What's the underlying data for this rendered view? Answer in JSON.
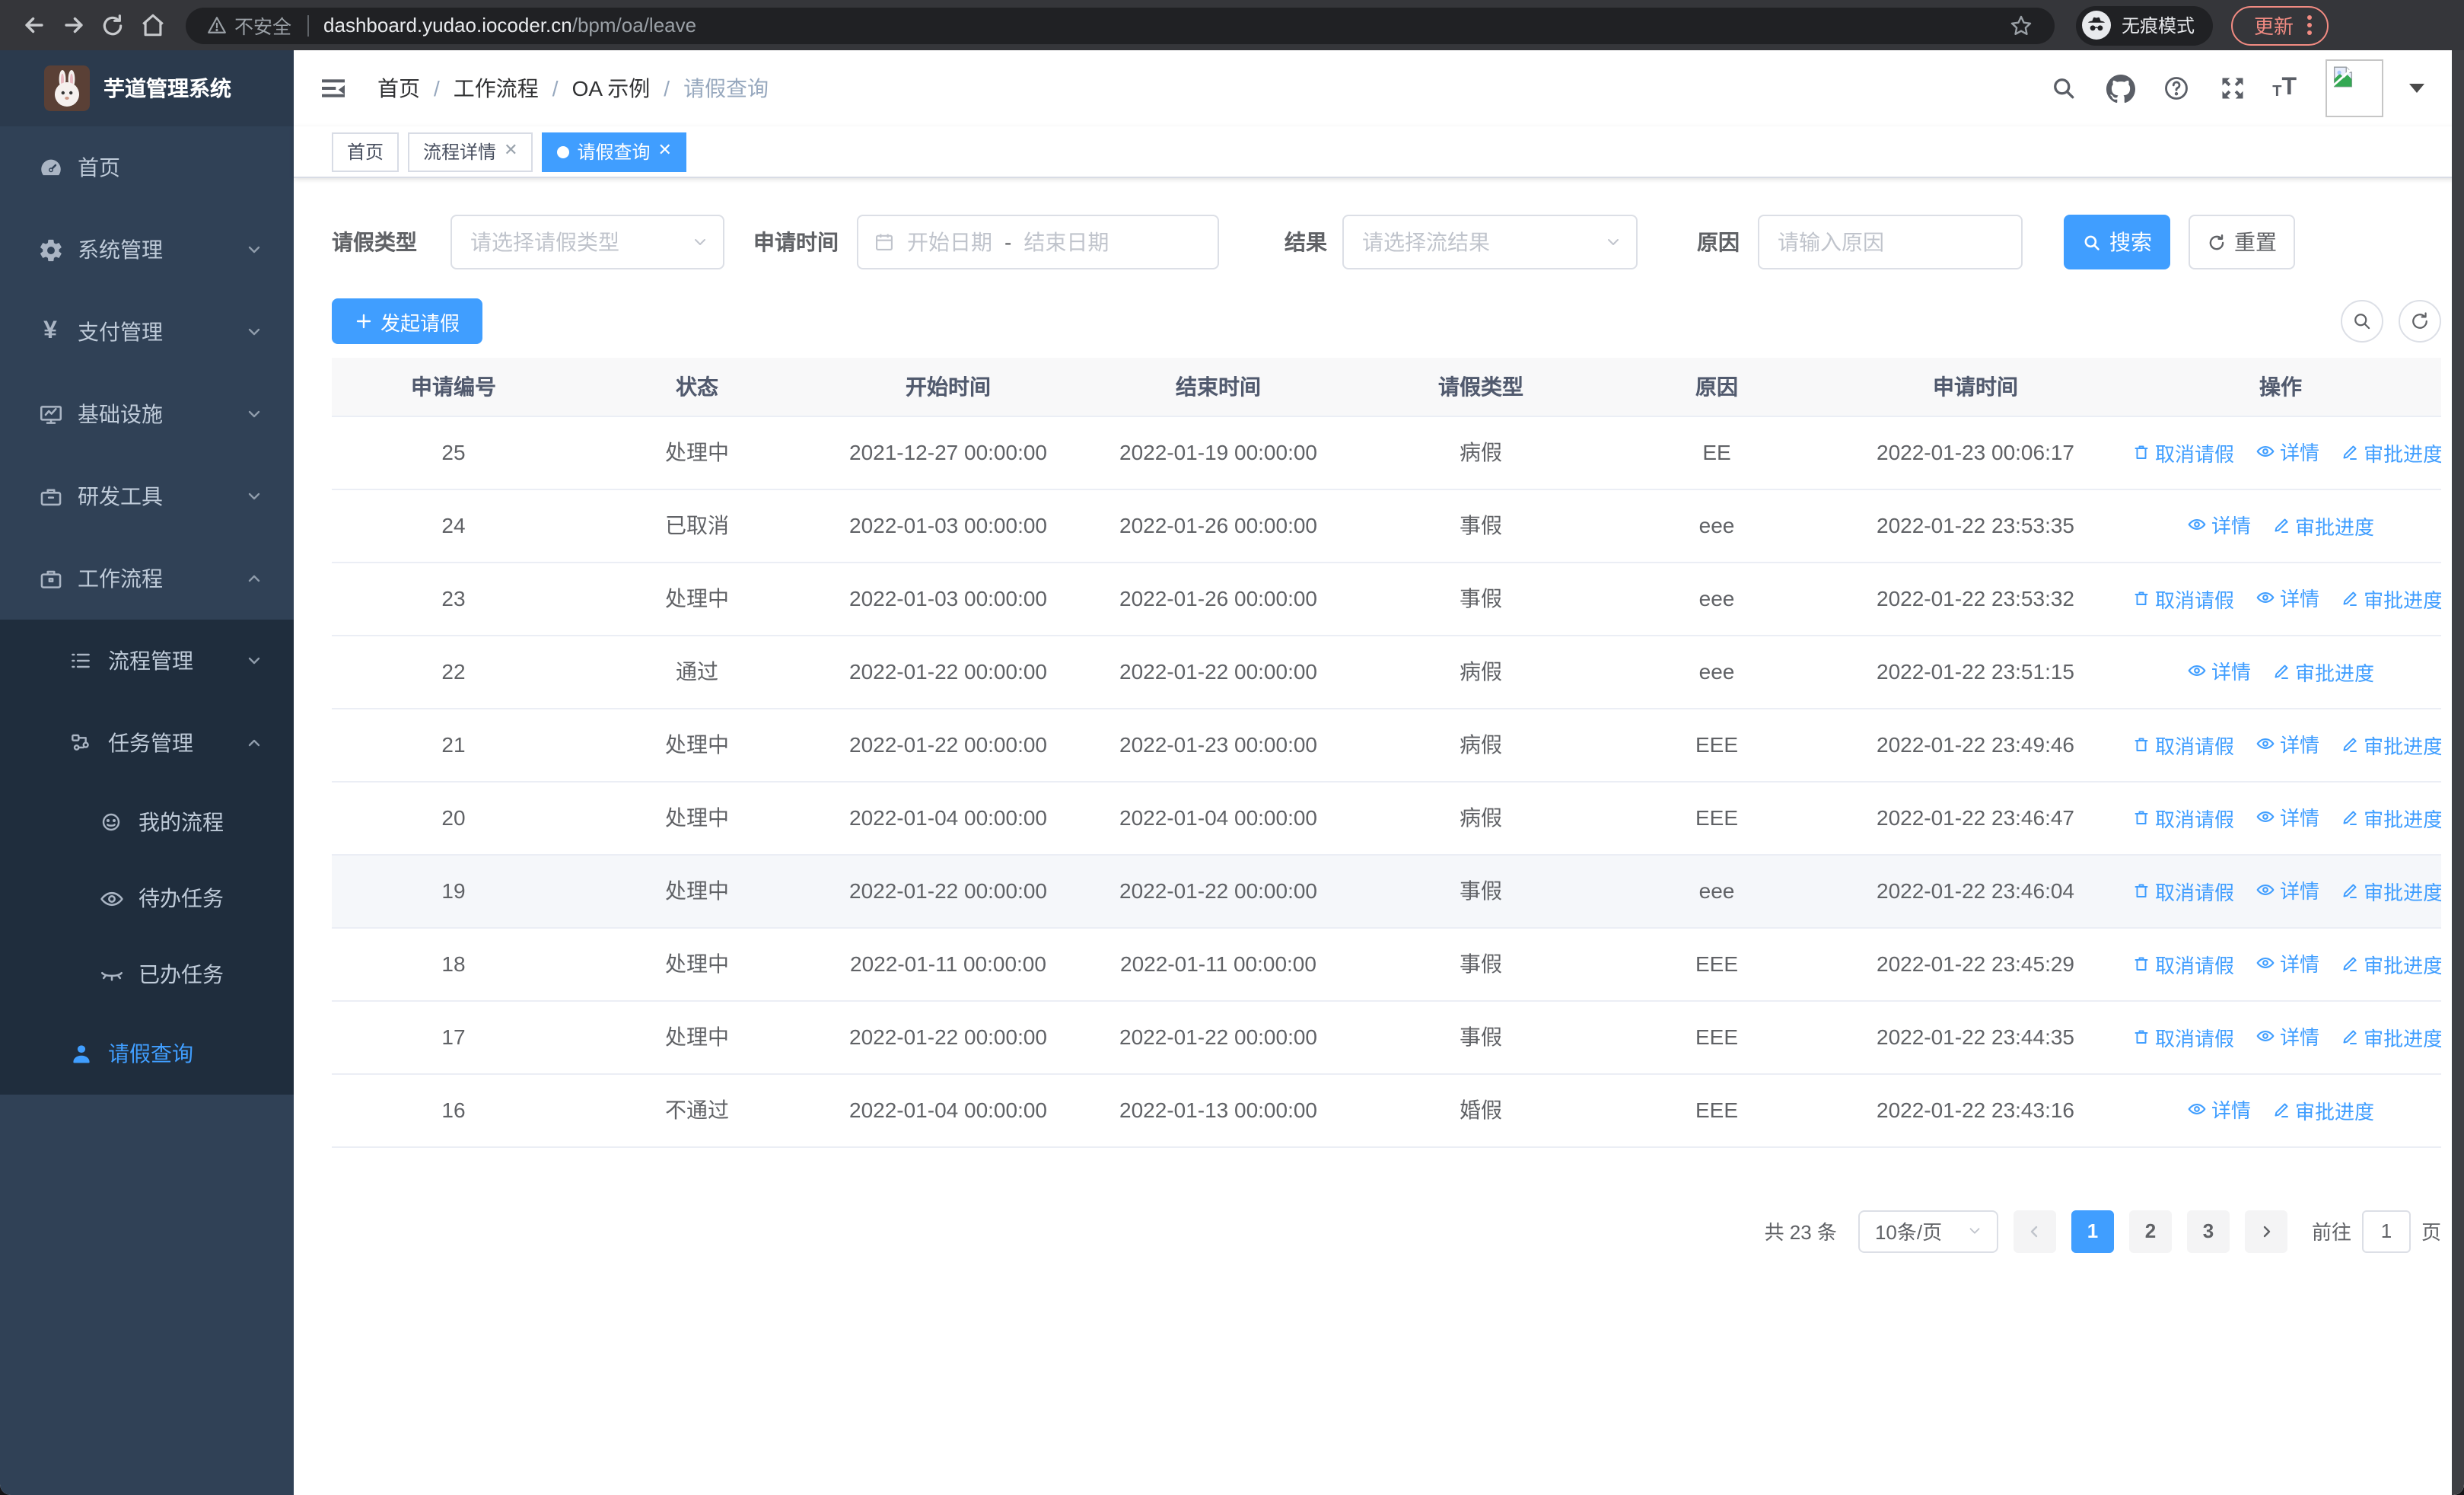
{
  "browser": {
    "security_label": "不安全",
    "url_domain": "dashboard.yudao.iocoder.cn",
    "url_path": "/bpm/oa/leave",
    "incognito_label": "无痕模式",
    "update_label": "更新"
  },
  "sidebar": {
    "title": "芋道管理系统",
    "items": [
      {
        "label": "首页"
      },
      {
        "label": "系统管理"
      },
      {
        "label": "支付管理"
      },
      {
        "label": "基础设施"
      },
      {
        "label": "研发工具"
      },
      {
        "label": "工作流程"
      },
      {
        "label": "流程管理"
      },
      {
        "label": "任务管理"
      },
      {
        "label": "我的流程"
      },
      {
        "label": "待办任务"
      },
      {
        "label": "已办任务"
      },
      {
        "label": "请假查询"
      }
    ]
  },
  "breadcrumb": [
    "首页",
    "工作流程",
    "OA 示例",
    "请假查询"
  ],
  "tabs": [
    {
      "label": "首页"
    },
    {
      "label": "流程详情"
    },
    {
      "label": "请假查询"
    }
  ],
  "filters": {
    "leave_type_label": "请假类型",
    "leave_type_placeholder": "请选择请假类型",
    "apply_time_label": "申请时间",
    "date_start_placeholder": "开始日期",
    "date_separator": "-",
    "date_end_placeholder": "结束日期",
    "result_label": "结果",
    "result_placeholder": "请选择流结果",
    "reason_label": "原因",
    "reason_placeholder": "请输入原因",
    "search_label": "搜索",
    "reset_label": "重置"
  },
  "toolbar": {
    "create_label": "发起请假"
  },
  "table": {
    "columns": [
      "申请编号",
      "状态",
      "开始时间",
      "结束时间",
      "请假类型",
      "原因",
      "申请时间",
      "操作"
    ],
    "action_labels": {
      "cancel": "取消请假",
      "detail": "详情",
      "progress": "审批进度"
    },
    "rows": [
      {
        "id": "25",
        "status": "处理中",
        "start": "2021-12-27 00:00:00",
        "end": "2022-01-19 00:00:00",
        "type": "病假",
        "reason": "EE",
        "apply_time": "2022-01-23 00:06:17",
        "can_cancel": true,
        "highlight": false
      },
      {
        "id": "24",
        "status": "已取消",
        "start": "2022-01-03 00:00:00",
        "end": "2022-01-26 00:00:00",
        "type": "事假",
        "reason": "eee",
        "apply_time": "2022-01-22 23:53:35",
        "can_cancel": false,
        "highlight": false
      },
      {
        "id": "23",
        "status": "处理中",
        "start": "2022-01-03 00:00:00",
        "end": "2022-01-26 00:00:00",
        "type": "事假",
        "reason": "eee",
        "apply_time": "2022-01-22 23:53:32",
        "can_cancel": true,
        "highlight": false
      },
      {
        "id": "22",
        "status": "通过",
        "start": "2022-01-22 00:00:00",
        "end": "2022-01-22 00:00:00",
        "type": "病假",
        "reason": "eee",
        "apply_time": "2022-01-22 23:51:15",
        "can_cancel": false,
        "highlight": false
      },
      {
        "id": "21",
        "status": "处理中",
        "start": "2022-01-22 00:00:00",
        "end": "2022-01-23 00:00:00",
        "type": "病假",
        "reason": "EEE",
        "apply_time": "2022-01-22 23:49:46",
        "can_cancel": true,
        "highlight": false
      },
      {
        "id": "20",
        "status": "处理中",
        "start": "2022-01-04 00:00:00",
        "end": "2022-01-04 00:00:00",
        "type": "病假",
        "reason": "EEE",
        "apply_time": "2022-01-22 23:46:47",
        "can_cancel": true,
        "highlight": false
      },
      {
        "id": "19",
        "status": "处理中",
        "start": "2022-01-22 00:00:00",
        "end": "2022-01-22 00:00:00",
        "type": "事假",
        "reason": "eee",
        "apply_time": "2022-01-22 23:46:04",
        "can_cancel": true,
        "highlight": true
      },
      {
        "id": "18",
        "status": "处理中",
        "start": "2022-01-11 00:00:00",
        "end": "2022-01-11 00:00:00",
        "type": "事假",
        "reason": "EEE",
        "apply_time": "2022-01-22 23:45:29",
        "can_cancel": true,
        "highlight": false
      },
      {
        "id": "17",
        "status": "处理中",
        "start": "2022-01-22 00:00:00",
        "end": "2022-01-22 00:00:00",
        "type": "事假",
        "reason": "EEE",
        "apply_time": "2022-01-22 23:44:35",
        "can_cancel": true,
        "highlight": false
      },
      {
        "id": "16",
        "status": "不通过",
        "start": "2022-01-04 00:00:00",
        "end": "2022-01-13 00:00:00",
        "type": "婚假",
        "reason": "EEE",
        "apply_time": "2022-01-22 23:43:16",
        "can_cancel": false,
        "highlight": false
      }
    ]
  },
  "pagination": {
    "total": "共 23 条",
    "page_size": "10条/页",
    "pages": [
      "1",
      "2",
      "3"
    ],
    "active_page": "1",
    "goto_label": "前往",
    "goto_value": "1",
    "goto_suffix": "页"
  },
  "colors": {
    "primary": "#409eff",
    "sidebar_bg": "#304156",
    "submenu_bg": "#1f2d3d",
    "update_accent": "#f28b82"
  }
}
